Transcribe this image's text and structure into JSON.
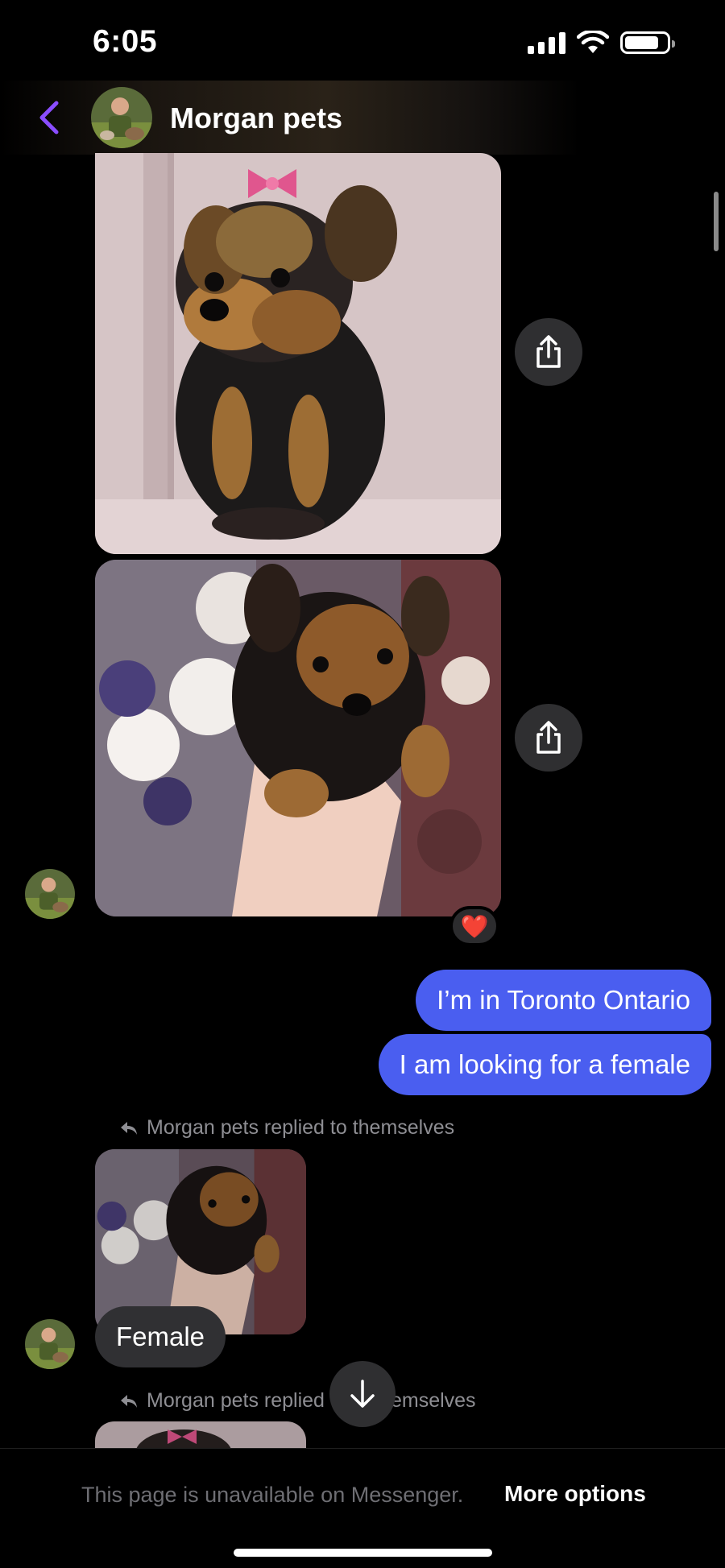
{
  "status_bar": {
    "time": "6:05",
    "battery_level": 0.82
  },
  "header": {
    "title": "Morgan pets"
  },
  "messages": {
    "sent": [
      "I’m in Toronto Ontario",
      "I am looking for a female"
    ],
    "reply_label_1": "Morgan pets replied to themselves",
    "reply_label_2_left": "Morgan pets replied",
    "reply_label_2_right": "emselves",
    "received_text": "Female",
    "reaction": "❤️"
  },
  "footer": {
    "notice": "This page is unavailable on Messenger.",
    "link": "More options"
  },
  "colors": {
    "accent": "#8a4dff",
    "sent_bubble": "#4a5ef0",
    "received_bubble": "#303033"
  },
  "icons": [
    "back-chevron-icon",
    "share-icon",
    "reply-arrow-icon",
    "arrow-down-icon",
    "signal-icon",
    "wifi-icon",
    "battery-icon"
  ]
}
